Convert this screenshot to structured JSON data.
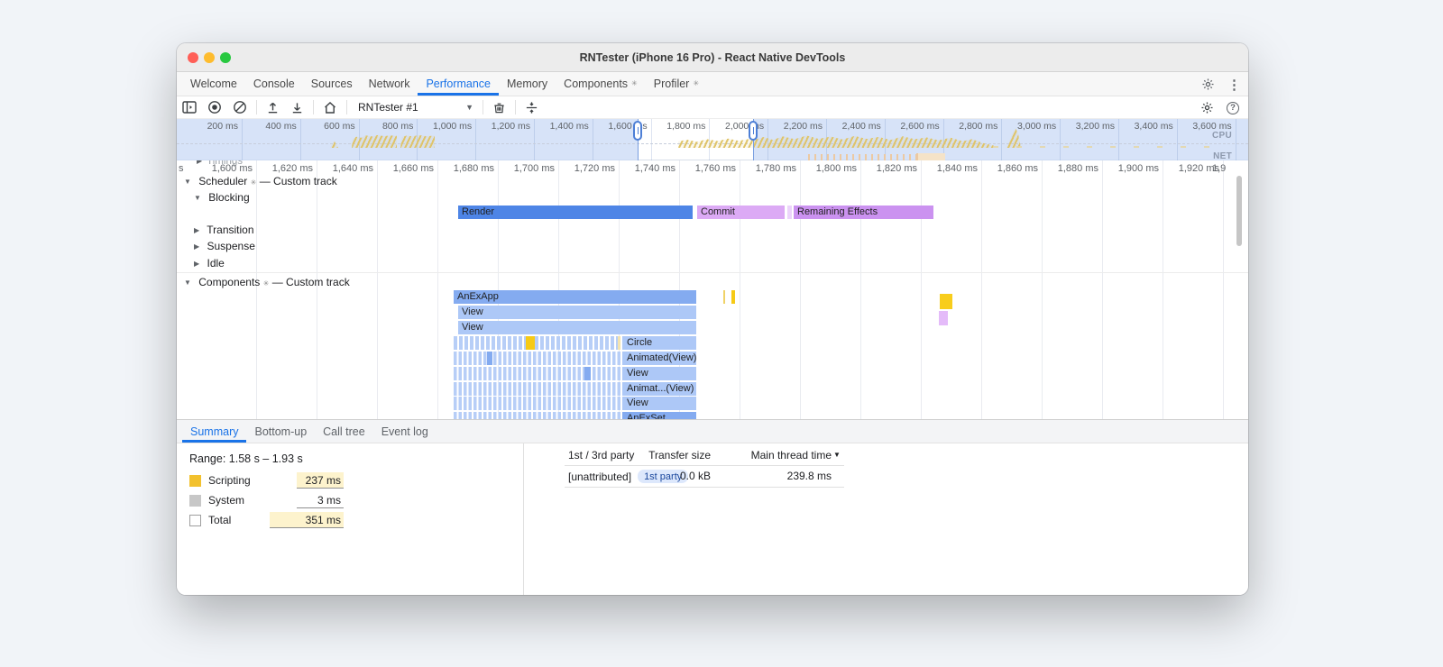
{
  "window": {
    "title": "RNTester (iPhone 16 Pro) - React Native DevTools"
  },
  "tabbar": {
    "badge": "✳",
    "items": [
      {
        "label": "Welcome"
      },
      {
        "label": "Console"
      },
      {
        "label": "Sources"
      },
      {
        "label": "Network"
      },
      {
        "label": "Performance"
      },
      {
        "label": "Memory"
      },
      {
        "label": "Components"
      },
      {
        "label": "Profiler"
      }
    ]
  },
  "toolbar": {
    "select_value": "RNTester #1"
  },
  "overview": {
    "cpu_label": "CPU",
    "net_label": "NET",
    "ticks": [
      "200 ms",
      "400 ms",
      "600 ms",
      "800 ms",
      "1,000 ms",
      "1,200 ms",
      "1,400 ms",
      "1,600 ms",
      "1,800 ms",
      "2,000 ms",
      "2,200 ms",
      "2,400 ms",
      "2,600 ms",
      "2,800 ms",
      "3,000 ms",
      "3,200 ms",
      "3,400 ms",
      "3,600 ms"
    ]
  },
  "timeline": {
    "stray_label": "s",
    "partial_tick": "1,9",
    "ticks": [
      "1,600 ms",
      "1,620 ms",
      "1,640 ms",
      "1,660 ms",
      "1,680 ms",
      "1,700 ms",
      "1,720 ms",
      "1,740 ms",
      "1,760 ms",
      "1,780 ms",
      "1,800 ms",
      "1,820 ms",
      "1,840 ms",
      "1,860 ms",
      "1,880 ms",
      "1,900 ms",
      "1,920 ms"
    ],
    "badge": "✳",
    "custom_suffix": "— Custom track",
    "tracks": {
      "timings": "Timings",
      "scheduler": "Scheduler",
      "blocking": "Blocking",
      "transition": "Transition",
      "suspense": "Suspense",
      "idle": "Idle",
      "components": "Components"
    },
    "scheduler_bars": {
      "render": "Render",
      "commit": "Commit",
      "remaining": "Remaining Effects"
    },
    "component_bars": {
      "r1": "AnExApp",
      "r2": "View",
      "r3": "View",
      "r4": "Circle",
      "r5": "Animated(View)",
      "r6": "View",
      "r7": "Animat...(View)",
      "r8": "View",
      "r9": "AnExSet"
    }
  },
  "bottom": {
    "tabs": [
      {
        "label": "Summary"
      },
      {
        "label": "Bottom-up"
      },
      {
        "label": "Call tree"
      },
      {
        "label": "Event log"
      }
    ],
    "summary": {
      "range": "Range: 1.58 s – 1.93 s",
      "legend": [
        {
          "label": "Scripting",
          "value": "237 ms"
        },
        {
          "label": "System",
          "value": "3 ms"
        },
        {
          "label": "Total",
          "value": "351 ms"
        }
      ]
    },
    "party_table": {
      "col_party": "1st / 3rd party",
      "col_transfer": "Transfer size",
      "col_main": "Main thread time",
      "sort_arrow": "▼",
      "row_name": "[unattributed]",
      "row_chip": "1st party",
      "row_transfer": "0.0 kB",
      "row_main": "239.8 ms"
    }
  },
  "colors": {
    "accent": "#1a73e8",
    "render_blue": "#4e85e6",
    "commit_purple": "#dcaaf5",
    "effects_purple": "#cb92f0",
    "flame_medium": "#84abf0",
    "flame_light": "#adc8f7",
    "scripting_yellow": "#f2c12e",
    "system_grey": "#c7c7c7"
  }
}
